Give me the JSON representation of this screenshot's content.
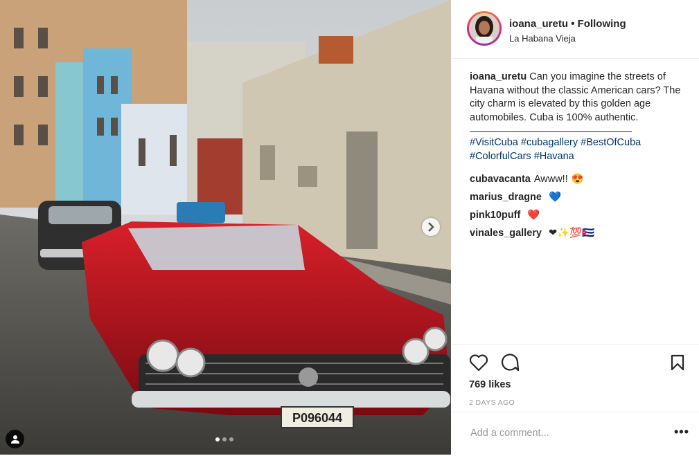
{
  "post": {
    "username": "ioana_uretu",
    "separator": "•",
    "follow_status": "Following",
    "location": "La Habana Vieja",
    "caption_text": "Can you imagine the streets of Havana without the classic American cars? The city charm is elevated by this golden age automobiles. Cuba is 100% authentic.",
    "hashtags": [
      "#VisitCuba",
      "#cubagallery",
      "#BestOfCuba",
      "#ColorfulCars",
      "#Havana"
    ],
    "comments": [
      {
        "user": "cubavacanta",
        "text": "Awww!!",
        "emoji": "😍"
      },
      {
        "user": "marius_dragne",
        "text": "",
        "emoji": "💙"
      },
      {
        "user": "pink10puff",
        "text": "",
        "emoji": "❤️"
      },
      {
        "user": "vinales_gallery",
        "text": "",
        "emoji": "❤✨💯🇨🇺"
      }
    ],
    "likes": "769 likes",
    "date": "2 DAYS AGO",
    "comment_placeholder": "Add a comment...",
    "more_label": "•••",
    "license_plate": "P096044",
    "carousel": {
      "count": 3,
      "active": 0
    }
  },
  "icons": {
    "like": "heart-icon",
    "comment": "comment-icon",
    "save": "bookmark-icon",
    "next": "chevron-right-icon",
    "tagged": "user-icon"
  },
  "colors": {
    "hashtag": "#003569",
    "text": "#262626",
    "muted": "#999999",
    "avatar_ring_start": "#f58529",
    "avatar_ring_end": "#dd2a7b"
  }
}
